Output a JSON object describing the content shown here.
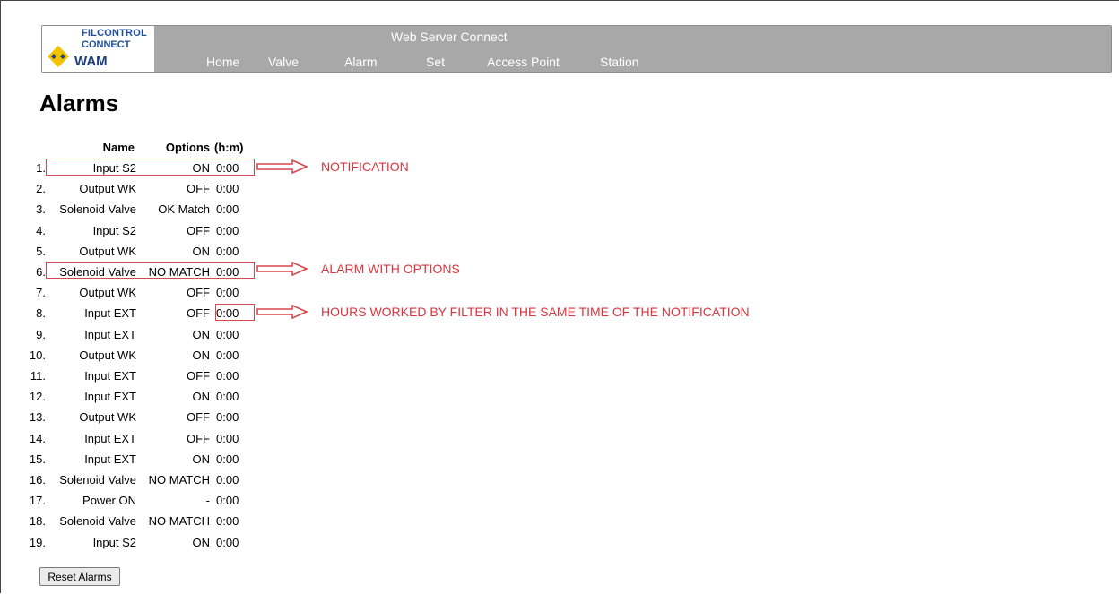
{
  "header": {
    "logo": {
      "line1": "FILCONTROL",
      "line2": "CONNECT",
      "line3": "WAM"
    },
    "title": "Web Server Connect",
    "nav": [
      "Home",
      "Valve",
      "Alarm",
      "Set",
      "Access Point",
      "Station"
    ]
  },
  "page": {
    "title": "Alarms"
  },
  "table": {
    "headers": {
      "name": "Name",
      "options": "Options",
      "time": "(h:m)"
    },
    "rows": [
      {
        "num": "1.",
        "name": "Input S2",
        "options": "ON",
        "time": "0:00"
      },
      {
        "num": "2.",
        "name": "Output WK",
        "options": "OFF",
        "time": "0:00"
      },
      {
        "num": "3.",
        "name": "Solenoid Valve",
        "options": "OK Match",
        "time": "0:00"
      },
      {
        "num": "4.",
        "name": "Input S2",
        "options": "OFF",
        "time": "0:00"
      },
      {
        "num": "5.",
        "name": "Output WK",
        "options": "ON",
        "time": "0:00"
      },
      {
        "num": "6.",
        "name": "Solenoid Valve",
        "options": "NO MATCH",
        "time": "0:00"
      },
      {
        "num": "7.",
        "name": "Output WK",
        "options": "OFF",
        "time": "0:00"
      },
      {
        "num": "8.",
        "name": "Input EXT",
        "options": "OFF",
        "time": "0:00"
      },
      {
        "num": "9.",
        "name": "Input EXT",
        "options": "ON",
        "time": "0:00"
      },
      {
        "num": "10.",
        "name": "Output WK",
        "options": "ON",
        "time": "0:00"
      },
      {
        "num": "11.",
        "name": "Input EXT",
        "options": "OFF",
        "time": "0:00"
      },
      {
        "num": "12.",
        "name": "Input EXT",
        "options": "ON",
        "time": "0:00"
      },
      {
        "num": "13.",
        "name": "Output WK",
        "options": "OFF",
        "time": "0:00"
      },
      {
        "num": "14.",
        "name": "Input EXT",
        "options": "OFF",
        "time": "0:00"
      },
      {
        "num": "15.",
        "name": "Input EXT",
        "options": "ON",
        "time": "0:00"
      },
      {
        "num": "16.",
        "name": "Solenoid Valve",
        "options": "NO MATCH",
        "time": "0:00"
      },
      {
        "num": "17.",
        "name": "Power ON",
        "options": "-",
        "time": "0:00"
      },
      {
        "num": "18.",
        "name": "Solenoid Valve",
        "options": "NO MATCH",
        "time": "0:00"
      },
      {
        "num": "19.",
        "name": "Input S2",
        "options": "ON",
        "time": "0:00"
      }
    ]
  },
  "annotations": {
    "notification": "NOTIFICATION",
    "alarm_with_options": "ALARM WITH OPTIONS",
    "hours_worked": "HOURS WORKED BY FILTER IN THE SAME TIME OF THE NOTIFICATION",
    "color": "#d9363e"
  },
  "buttons": {
    "reset": "Reset Alarms"
  },
  "colors": {
    "header_bg": "#a8a8a8",
    "brand": "#1e4f9a",
    "logo_diamond": "#f2c300"
  }
}
